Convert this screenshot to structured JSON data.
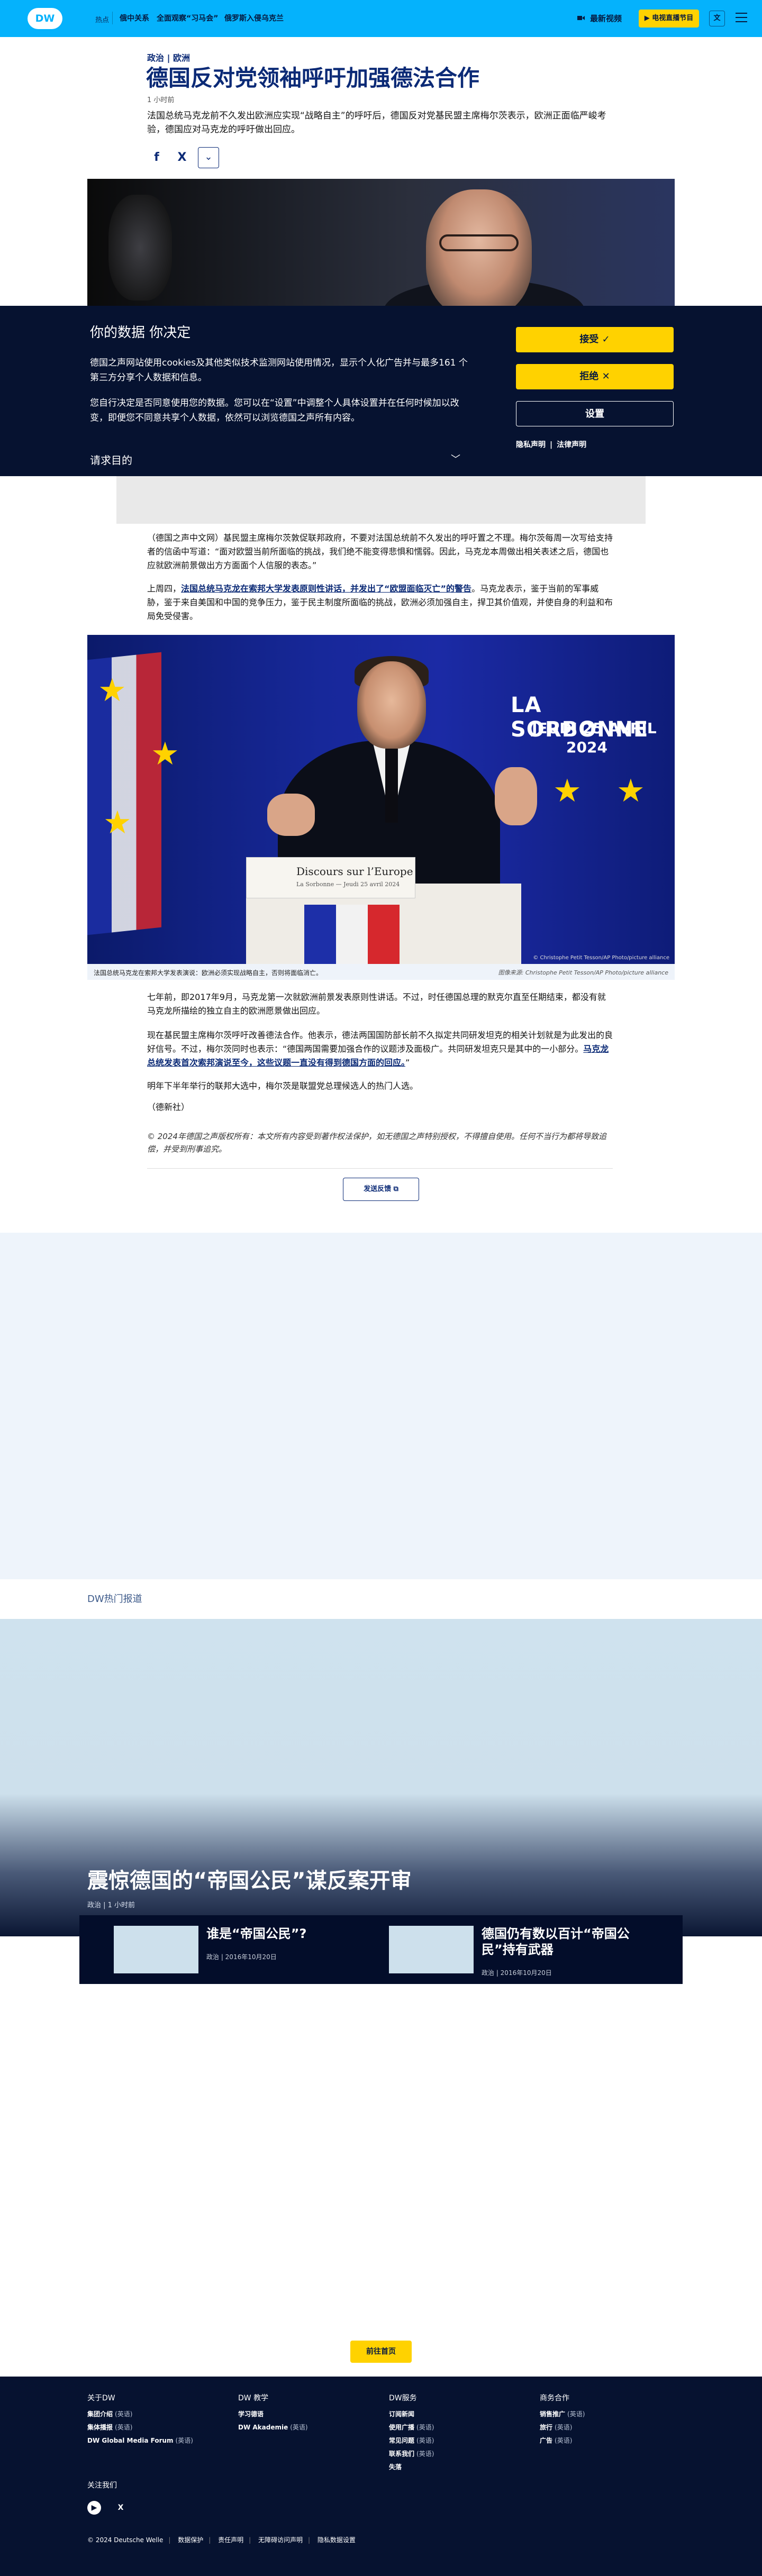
{
  "header": {
    "logo": "DW",
    "hot_label": "热点",
    "hot_items": [
      "俄中关系",
      "全面观察“习马会”",
      "俄罗斯入侵乌克兰"
    ],
    "latest_video": "最新视频",
    "tv_button": "电视直播节目",
    "lang_button": "文"
  },
  "article": {
    "breadcrumb": "政治 | 欧洲",
    "headline": "德国反对党领袖呼吁加强德法合作",
    "timestamp": "1 小时前",
    "teaser": "法国总统马克龙前不久发出欧洲应实现“战略自主”的呼吁后，德国反对党基民盟主席梅尔茨表示，欧洲正面临严峻考验，德国应对马克龙的呼吁做出回应。",
    "share": {
      "facebook": "f",
      "x": "X",
      "more": "⌄"
    }
  },
  "consent": {
    "title": "你的数据 你决定",
    "p1": "德国之声网站使用cookies及其他类似技术监测网站使用情况，显示个人化广告并与最多161 个第三方分享个人数据和信息。",
    "p2": "您自行决定是否同意使用您的数据。您可以在“设置”中调整个人具体设置并在任何时候加以改变，即便您不同意共享个人数据，依然可以浏览德国之声所有内容。",
    "purposes": "请求目的",
    "accept": "接受 ✓",
    "reject": "拒绝 ✕",
    "settings": "设置",
    "privacy": "隐私声明",
    "legal": "法律声明"
  },
  "body": {
    "p1": "（德国之声中文网）基民盟主席梅尔茨敦促联邦政府，不要对法国总统前不久发出的呼吁置之不理。梅尔茨每周一次写给支持者的信函中写道：“面对欧盟当前所面临的挑战，我们绝不能变得悲惧和懦弱。因此，马克龙本周做出相关表述之后，德国也应就欧洲前景做出方方面面个人信服的表态。”",
    "p2_pre": "上周四，",
    "p2_link": "法国总统马克龙在索邦大学发表原则性讲话，并发出了“欧盟面临灭亡”的警告",
    "p2_post": "。马克龙表示，鉴于当前的军事威胁，鉴于来自美国和中国的竞争压力，鉴于民主制度所面临的挑战，欧洲必须加强自主，捍卫其价值观，并使自身的利益和布局免受侵害。",
    "photo_caption": "法国总统马克龙在索邦大学发表演说：欧洲必须实现战略自主，否则将面临消亡。",
    "photo_credit": "图像来源: Christophe Petit Tesson/AP Photo/picture alliance",
    "photo_watermark": "© Christophe Petit Tesson/AP Photo/picture alliance",
    "photo_text1": "LA SORBONNE",
    "photo_text2": "JEUDI 25 AVRIL",
    "photo_text3": "2024",
    "podium_title": "Discours sur l’Europe",
    "podium_sub": "La Sorbonne — Jeudi 25 avril 2024",
    "p3": "七年前，即2017年9月，马克龙第一次就欧洲前景发表原则性讲话。不过，时任德国总理的默克尔直至任期结束，都没有就马克龙所描绘的独立自主的欧洲愿景做出回应。",
    "p4_pre": "现在基民盟主席梅尔茨呼吁改善德法合作。他表示，德法两国国防部长前不久拟定共同研发坦克的相关计划就是为此发出的良好信号。不过，梅尔茨同时也表示：“德国两国需要加强合作的议题涉及面极广。共同研发坦克只是其中的一小部分。",
    "p4_link": "马克龙总统发表首次索邦演说至今，这些议题一直没有得到德国方面的回应。",
    "p4_post": "”",
    "p5": "明年下半年举行的联邦大选中，梅尔茨是联盟党总理候选人的热门人选。",
    "p6": "（德新社）",
    "copyright": "© 2024年德国之声版权所有：本文所有内容受到著作权法保护，如无德国之声特别授权，不得擅自使用。任何不当行为都将导致追偿，并受到刑事追究。",
    "feedback": "发送反馈 ⧉"
  },
  "topstories": {
    "section": "DW热门报道",
    "title": "震惊德国的“帝国公民”谋反案开审",
    "meta": "政治 | 1 小时前",
    "related": [
      {
        "title": "谁是“帝国公民”?",
        "meta": "政治 | 2016年10月20日"
      },
      {
        "title": "德国仍有数以百计“帝国公民”持有武器",
        "meta": "政治 | 2016年10月20日"
      }
    ]
  },
  "home_button": "前往首页",
  "footer": {
    "cols": [
      {
        "title": "关于DW",
        "links": [
          [
            "集团介绍",
            "(英语)"
          ],
          [
            "集体播报",
            "(英语)"
          ],
          [
            "DW Global Media Forum",
            "(英语)"
          ]
        ]
      },
      {
        "title": "DW 教学",
        "links": [
          [
            "学习德语",
            ""
          ],
          [
            "DW Akademie",
            "(英语)"
          ]
        ]
      },
      {
        "title": "DW服务",
        "links": [
          [
            "订阅新闻",
            ""
          ],
          [
            "使用广播",
            "(英语)"
          ],
          [
            "常见问题",
            "(英语)"
          ],
          [
            "联系我们",
            "(英语)"
          ],
          [
            "失落",
            ""
          ]
        ]
      },
      {
        "title": "商务合作",
        "links": [
          [
            "销售推广",
            "(英语)"
          ],
          [
            "旅行",
            "(英语)"
          ],
          [
            "广告",
            "(英语)"
          ]
        ]
      }
    ],
    "follow": "关注我们",
    "bottom": [
      "© 2024 Deutsche Welle",
      "数据保护",
      "责任声明",
      "无障碍访问声明",
      "隐私数据设置"
    ]
  },
  "colors": {
    "brand": "#05b2fc",
    "navy": "#061230",
    "accent_yellow": "#ffd200",
    "link_blue": "#0b2a76"
  },
  "icons": [
    "dw-logo",
    "video-icon",
    "menu-icon",
    "facebook-icon",
    "x-icon",
    "chevron-down-icon",
    "youtube-icon",
    "external-link-icon"
  ]
}
